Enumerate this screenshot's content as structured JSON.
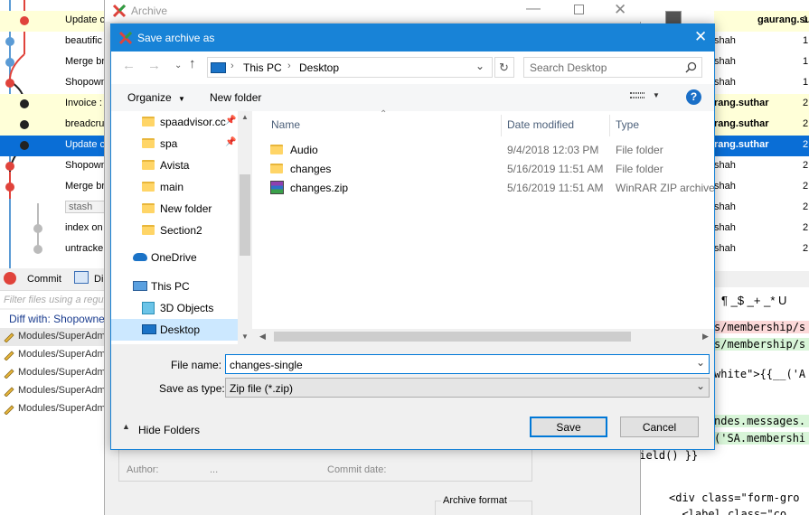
{
  "bg_left": {
    "commits": [
      {
        "msg": "Update c",
        "style": "alt"
      },
      {
        "msg": "beautific",
        "style": ""
      },
      {
        "msg": "Merge br",
        "style": ""
      },
      {
        "msg": "Shopown",
        "style": ""
      },
      {
        "msg": "Invoice :",
        "style": "alt"
      },
      {
        "msg": "breadcru",
        "style": "alt"
      },
      {
        "msg": "Update c",
        "style": "sel"
      },
      {
        "msg": "Shopown",
        "style": ""
      },
      {
        "msg": "Merge br",
        "style": ""
      },
      {
        "msg": "stash",
        "style": "stash"
      },
      {
        "msg": "index on",
        "style": ""
      },
      {
        "msg": "untracke",
        "style": ""
      }
    ],
    "commit_tab": "Commit",
    "diff_tab": "Di",
    "filter_placeholder": "Filter files using a regul",
    "diff_with": "Diff with: Shopowne",
    "files": [
      "Modules/SuperAdmi",
      "Modules/SuperAdmi",
      "Modules/SuperAdmi",
      "Modules/SuperAdmi",
      "Modules/SuperAdmi"
    ]
  },
  "bg_right": {
    "rows": [
      {
        "name": "gaurang.suthar",
        "count": "1",
        "bold": true,
        "alt": true
      },
      {
        "name": "shah",
        "count": "1",
        "bold": false,
        "alt": false
      },
      {
        "name": "shah",
        "count": "1",
        "bold": false,
        "alt": false
      },
      {
        "name": "shah",
        "count": "1",
        "bold": false,
        "alt": false
      },
      {
        "name": "rang.suthar",
        "count": "2",
        "bold": true,
        "alt": true
      },
      {
        "name": "rang.suthar",
        "count": "2",
        "bold": true,
        "alt": true
      },
      {
        "name": "rang.suthar",
        "count": "2",
        "bold": true,
        "alt": false,
        "sel": true
      },
      {
        "name": "shah",
        "count": "2",
        "bold": false,
        "alt": false
      },
      {
        "name": "shah",
        "count": "2",
        "bold": false,
        "alt": false
      },
      {
        "name": "shah",
        "count": "2",
        "bold": false,
        "alt": false
      },
      {
        "name": "shah",
        "count": "2",
        "bold": false,
        "alt": false
      },
      {
        "name": "shah",
        "count": "2",
        "bold": false,
        "alt": false
      }
    ],
    "toolbar_glyphs": "¶ _$ _+ _* U",
    "code_lines": [
      "s/membership/s",
      "s/membership/s",
      "white\">{{__('A",
      "ndes.messages.",
      "('SA.membershi",
      "field() }}",
      "<div class=\"form-gro",
      "  <label class=\"co"
    ]
  },
  "archive": {
    "title": "Archive",
    "author_label": "Author:",
    "author_value": "...",
    "commit_date_label": "Commit date:",
    "archive_format_label": "Archive format"
  },
  "dialog": {
    "title": "Save archive as",
    "breadcrumb": [
      "This PC",
      "Desktop"
    ],
    "search_placeholder": "Search Desktop",
    "organize_label": "Organize",
    "new_folder_label": "New folder",
    "nav_items": [
      {
        "label": "spaadvisor.cc",
        "pinned": true,
        "icon": "folder"
      },
      {
        "label": "spa",
        "pinned": true,
        "icon": "folder"
      },
      {
        "label": "Avista",
        "pinned": false,
        "icon": "folder"
      },
      {
        "label": "main",
        "pinned": false,
        "icon": "folder"
      },
      {
        "label": "New folder",
        "pinned": false,
        "icon": "folder"
      },
      {
        "label": "Section2",
        "pinned": false,
        "icon": "folder"
      },
      {
        "label": "OneDrive",
        "pinned": false,
        "icon": "cloud"
      },
      {
        "label": "This PC",
        "pinned": false,
        "icon": "pc"
      },
      {
        "label": "3D Objects",
        "pinned": false,
        "icon": "cube"
      },
      {
        "label": "Desktop",
        "pinned": false,
        "icon": "desktop",
        "selected": true
      }
    ],
    "columns": {
      "name": "Name",
      "date": "Date modified",
      "type": "Type"
    },
    "files": [
      {
        "name": "Audio",
        "date": "9/4/2018 12:03 PM",
        "type": "File folder",
        "icon": "folder"
      },
      {
        "name": "changes",
        "date": "5/16/2019 11:51 AM",
        "type": "File folder",
        "icon": "folder"
      },
      {
        "name": "changes.zip",
        "date": "5/16/2019 11:51 AM",
        "type": "WinRAR ZIP archive",
        "icon": "winrar"
      }
    ],
    "file_name_label": "File name:",
    "file_name_value": "changes-single",
    "save_type_label": "Save as type:",
    "save_type_value": "Zip file (*.zip)",
    "hide_folders_label": "Hide Folders",
    "save_label": "Save",
    "cancel_label": "Cancel"
  },
  "colors": {
    "accent": "#1883d7",
    "selection": "#0a6ed6",
    "highlight": "#ffffd8",
    "nav_selected": "#cce8ff"
  }
}
